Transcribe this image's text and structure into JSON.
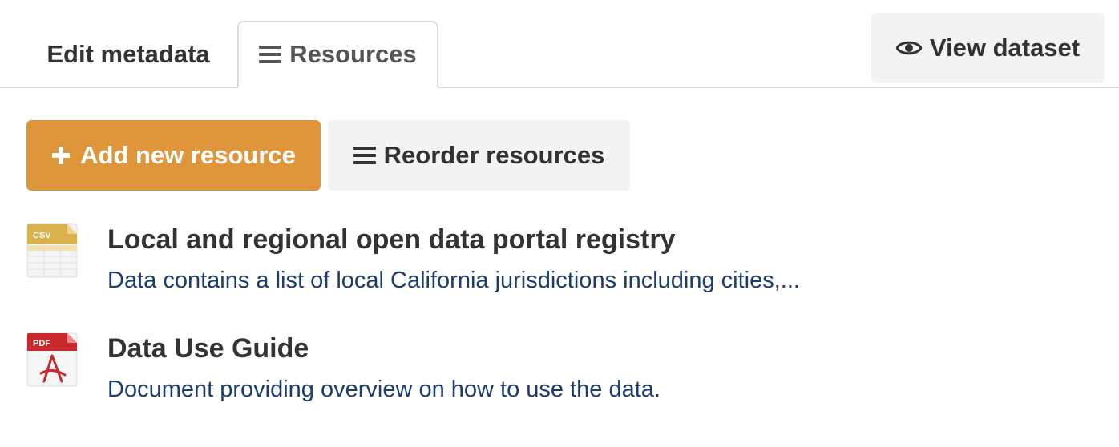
{
  "tabs": {
    "edit_metadata": "Edit metadata",
    "resources": "Resources"
  },
  "header": {
    "view_dataset": "View dataset"
  },
  "actions": {
    "add_new_resource": "Add new resource",
    "reorder_resources": "Reorder resources"
  },
  "resources": [
    {
      "format": "CSV",
      "title": "Local and regional open data portal registry",
      "description": "Data contains a list of local California jurisdictions including cities,..."
    },
    {
      "format": "PDF",
      "title": "Data Use Guide",
      "description": "Document providing overview on how to use the data."
    }
  ],
  "colors": {
    "accent": "#df963a",
    "link": "#1d3c6e",
    "button_bg": "#f3f3f3",
    "text": "#333333"
  },
  "icons": {
    "resources_tab": "hamburger-icon",
    "view_dataset": "eye-icon",
    "add_resource": "plus-icon",
    "reorder": "hamburger-icon",
    "csv": "csv-file-icon",
    "pdf": "pdf-file-icon"
  }
}
